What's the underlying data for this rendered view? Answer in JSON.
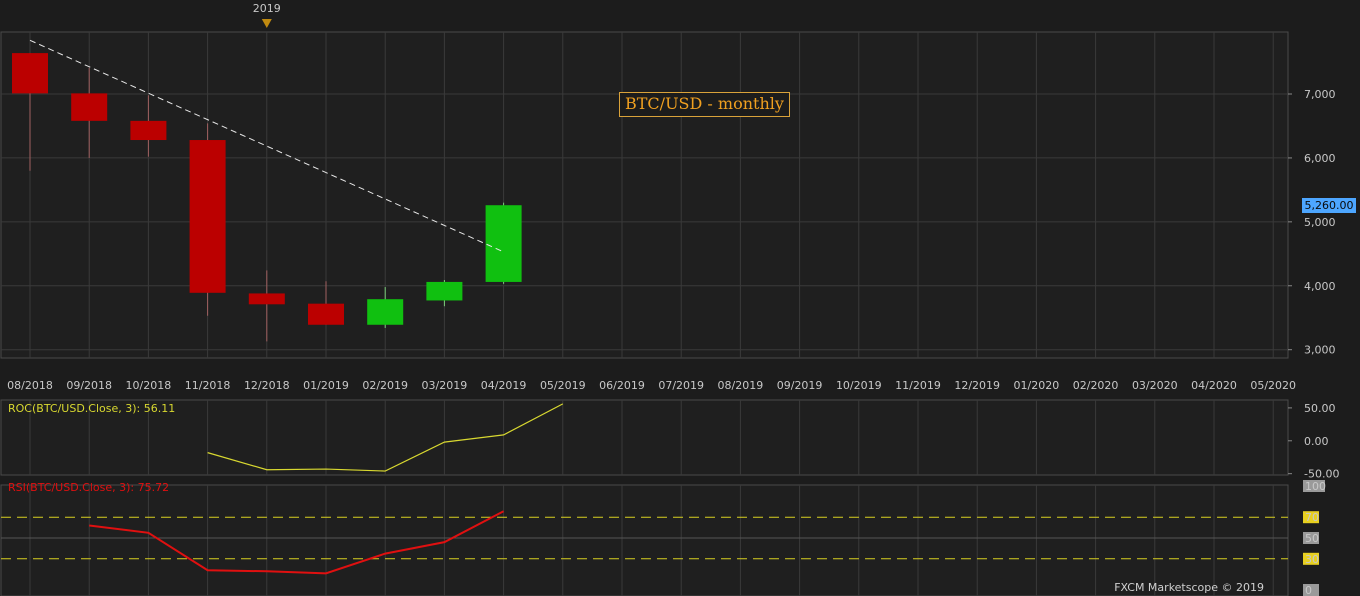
{
  "header": {
    "year_marker": "2019"
  },
  "title": "BTC/USD - monthly",
  "last_price_label": "5,260.00",
  "footer": "FXCM Marketscope © 2019",
  "colors": {
    "up": "#10c010",
    "down": "#bb0000",
    "roc": "#d8d830",
    "rsi": "#e01010",
    "rsi_level": "#d8d020",
    "price_tag": "#4da6ff"
  },
  "chart_data": [
    {
      "type": "candlestick",
      "title": "BTC/USD - monthly",
      "x": [
        "08/2018",
        "09/2018",
        "10/2018",
        "11/2018",
        "12/2018",
        "01/2019",
        "02/2019",
        "03/2019",
        "04/2019",
        "05/2019",
        "06/2019",
        "07/2019",
        "08/2019",
        "09/2019",
        "10/2019",
        "11/2019",
        "12/2019",
        "01/2020",
        "02/2020",
        "03/2020",
        "04/2020",
        "05/2020"
      ],
      "candles": [
        {
          "month": "08/2018",
          "open": 7640,
          "high": 7640,
          "low": 5800,
          "close": 7010
        },
        {
          "month": "09/2018",
          "open": 7010,
          "high": 7410,
          "low": 6000,
          "close": 6580
        },
        {
          "month": "10/2018",
          "open": 6580,
          "high": 6980,
          "low": 6020,
          "close": 6280
        },
        {
          "month": "11/2018",
          "open": 6280,
          "high": 6540,
          "low": 3530,
          "close": 3890
        },
        {
          "month": "12/2018",
          "open": 3880,
          "high": 4240,
          "low": 3130,
          "close": 3710
        },
        {
          "month": "01/2019",
          "open": 3720,
          "high": 4070,
          "low": 3390,
          "close": 3390
        },
        {
          "month": "02/2019",
          "open": 3390,
          "high": 3980,
          "low": 3340,
          "close": 3790
        },
        {
          "month": "03/2019",
          "open": 3770,
          "high": 4090,
          "low": 3680,
          "close": 4060
        },
        {
          "month": "04/2019",
          "open": 4060,
          "high": 5300,
          "low": 4030,
          "close": 5260
        }
      ],
      "trendline": {
        "from": {
          "month": "08/2018",
          "value": 7840
        },
        "to": {
          "month": "04/2019",
          "value": 4530
        }
      },
      "y_ticks": [
        3000,
        4000,
        5000,
        6000,
        7000
      ],
      "y_tick_labels": [
        "3,000",
        "4,000",
        "5,000",
        "6,000",
        "7,000"
      ],
      "ylim": [
        2870,
        7970
      ],
      "last_price": 5260,
      "grid": true
    },
    {
      "type": "line",
      "title": "ROC(BTC/USD.Close, 3): 56.11",
      "series": [
        {
          "values": [
            {
              "month": "11/2018",
              "value": -18
            },
            {
              "month": "12/2018",
              "value": -44
            },
            {
              "month": "01/2019",
              "value": -43
            },
            {
              "month": "02/2019",
              "value": -46
            },
            {
              "month": "03/2019",
              "value": -2
            },
            {
              "month": "04/2019",
              "value": 9
            },
            {
              "month": "05/2019",
              "value": 56.11
            }
          ]
        }
      ],
      "y_ticks": [
        50,
        0,
        -50
      ],
      "y_tick_labels": [
        "50.00",
        "0.00",
        "-50.00"
      ],
      "ylim": [
        -52,
        62
      ]
    },
    {
      "type": "line",
      "title": "RSI(BTC/USD.Close, 3): 75.72",
      "series": [
        {
          "values": [
            {
              "month": "09/2018",
              "value": 62
            },
            {
              "month": "10/2018",
              "value": 55
            },
            {
              "month": "11/2018",
              "value": 19
            },
            {
              "month": "12/2018",
              "value": 18
            },
            {
              "month": "01/2019",
              "value": 16
            },
            {
              "month": "02/2019",
              "value": 35
            },
            {
              "month": "03/2019",
              "value": 46
            },
            {
              "month": "04/2019",
              "value": 75.72
            }
          ]
        }
      ],
      "levels": [
        70,
        30
      ],
      "y_ticks": [
        100,
        70,
        50,
        30,
        0
      ],
      "y_tick_labels": [
        "100",
        "70",
        "50",
        "30",
        "0"
      ],
      "ylim": [
        0,
        100
      ]
    }
  ]
}
